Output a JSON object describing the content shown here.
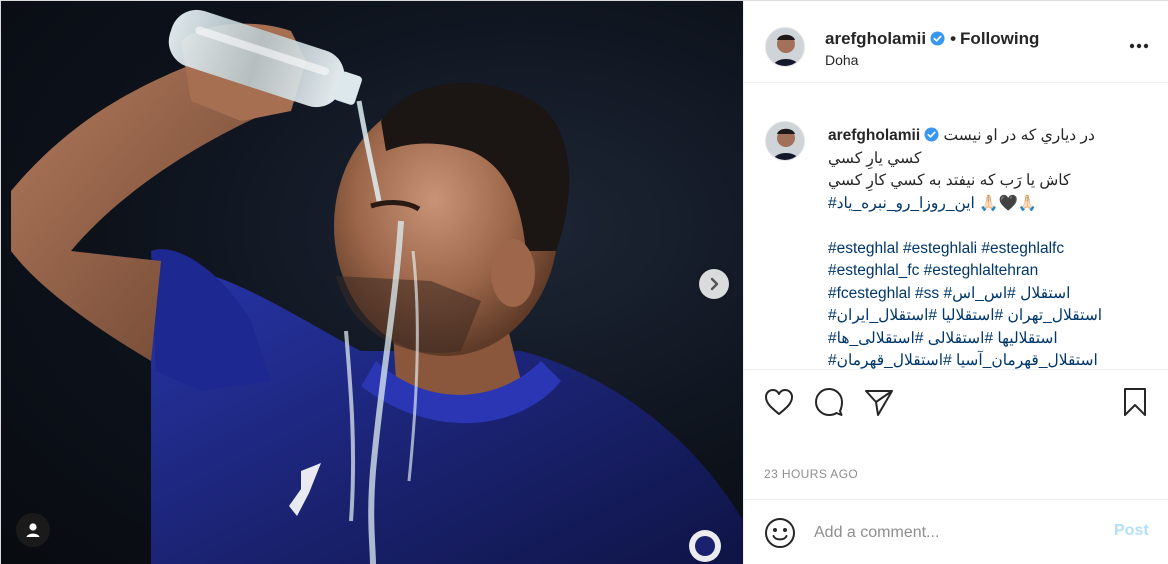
{
  "post": {
    "author": "arefgholamii",
    "verified": true,
    "follow_state": "Following",
    "separator": "•",
    "location": "Doha"
  },
  "caption": {
    "author": "arefgholamii",
    "lines": [
      "در دياري که در او نيست",
      "کسي يارِ کسي",
      "کاش يا رَب که نيفتد به کسي کارِ کسي",
      "#اين_روزا_رو_نبره_ياد 🙏🏻🖤🙏🏻"
    ],
    "hashtag_lines": [
      "#esteghlal #esteghlali #esteghlalfc",
      "#esteghlal_fc #esteghlaltehran",
      "#fcesteghlal #ss #استقلال #اس_اس",
      "#استقلال_تهران #استقلاليا #استقلال_ايران",
      "#استقلاليها #استقلالى #استقلالى_ها",
      "#استقلال_قهرمان_آسيا #استقلال_قهرمان"
    ]
  },
  "timestamp": "23 HOURS AGO",
  "comment": {
    "placeholder": "Add a comment...",
    "post_label": "Post"
  },
  "icons": {
    "more": "more-options-icon",
    "like": "heart-icon",
    "comment": "comment-bubble-icon",
    "share": "paper-plane-icon",
    "save": "bookmark-icon",
    "emoji": "smiley-icon",
    "next": "chevron-right-icon",
    "tags": "user-tag-icon",
    "verified": "verified-badge-icon"
  },
  "colors": {
    "verified_blue": "#3897f0",
    "hashtag_blue": "#00376b",
    "post_disabled": "#b2dffc",
    "jersey_blue": "#1f2a8c"
  }
}
